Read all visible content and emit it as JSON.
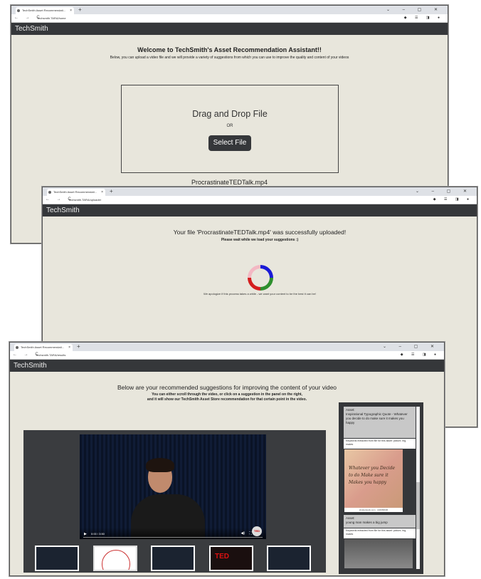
{
  "browser": {
    "tab_title": "TechSmith Asset Recommendati...",
    "new_tab": "+",
    "window_controls": "⌄ – ▢ ✕",
    "nav": "← → C",
    "ext_icons": "◆ ☰ ◨ ●"
  },
  "brand": "TechSmith",
  "window1": {
    "url": "Techsmith.TARA/home",
    "title": "Welcome to TechSmith's Asset Recommendation Assistant!!",
    "subtitle": "Below, you can upload a video file and we will provide a variety of suggestions from which you can use to improve the quality and content of your videos",
    "drop_title": "Drag and Drop File",
    "or": "OR",
    "select_button": "Select File",
    "filename": "ProcrastinateTEDTalk.mp4"
  },
  "window2": {
    "url": "Techsmith.TARA/uploader",
    "title": "Your file 'ProcrastinateTEDTalk.mp4' was successfully uploaded!",
    "subtitle": "Please wait while we load your suggestions :)",
    "apology": "We apologize if this process takes a while - we want your content to be the best it can be!"
  },
  "window3": {
    "url": "Techsmith.TARA/results",
    "title": "Below are your recommended suggestions for improving the content of your video",
    "subtitle1": "You can either scroll through the video, or click on a suggestion in the panel on the right,",
    "subtitle2": "and it will show our TechSmith Asset Store recommendation for that certain point in the video.",
    "video_time": "0:00 / 3:50",
    "ted_badge": "TED",
    "suggestions": [
      {
        "head": "Asset:\nInspirational Typographic Quote - Whatever you decide to do make sure it makes you happy",
        "keywords": "Keywords extracted from file for this asset: picture, big, makes",
        "image_text": "Whatever you Decide to do Make sure it Makes you happy",
        "image_credit": "shutterstock.com · 222983606"
      },
      {
        "head": "Asset:\nyoung man makes a big jump",
        "keywords": "Keywords extracted from file for this asset: picture, big, makes"
      }
    ]
  }
}
